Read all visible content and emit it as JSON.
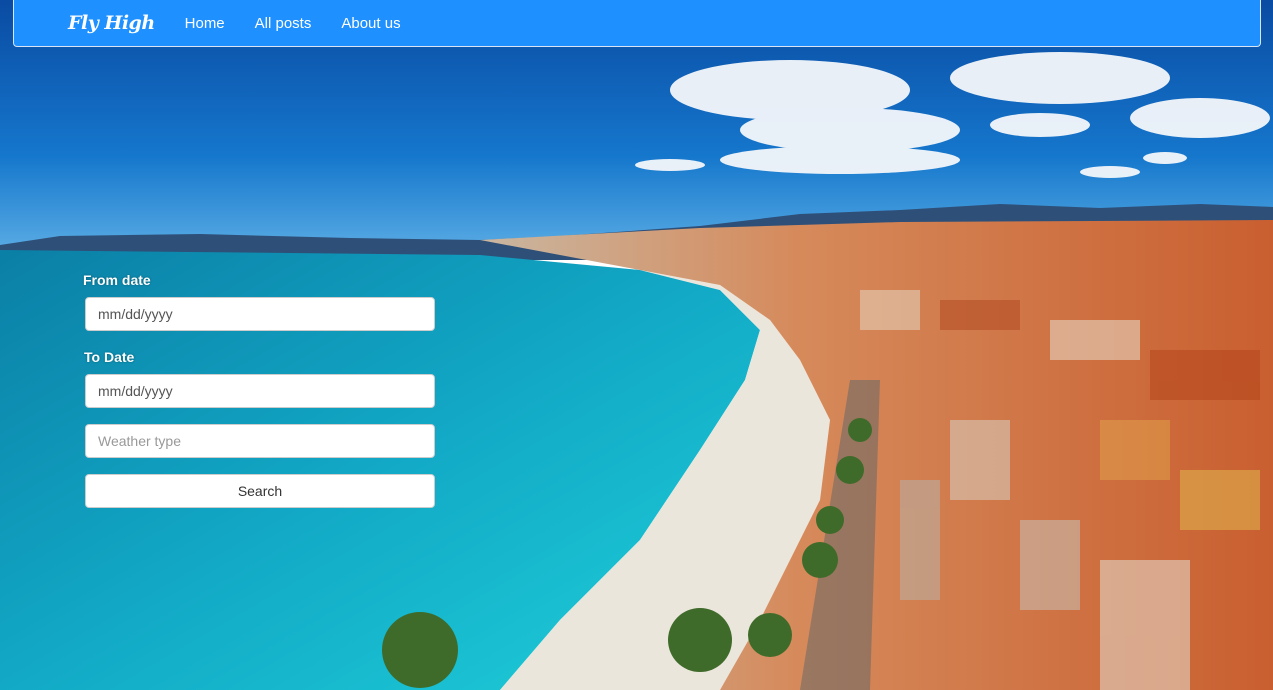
{
  "navbar": {
    "brand": "Fly High",
    "links": [
      "Home",
      "All posts",
      "About us"
    ]
  },
  "search": {
    "from_label": "From date",
    "from_value": "mm/dd/yyyy",
    "to_label": "To Date",
    "to_value": "mm/dd/yyyy",
    "weather_placeholder": "Weather type",
    "button_label": "Search"
  },
  "colors": {
    "navbar": "#1e90ff",
    "sky_top": "#0a4fa8",
    "sea": "#0fb3c9",
    "beach": "#ece8e0",
    "roofs": "#d2693a"
  },
  "icons": {}
}
